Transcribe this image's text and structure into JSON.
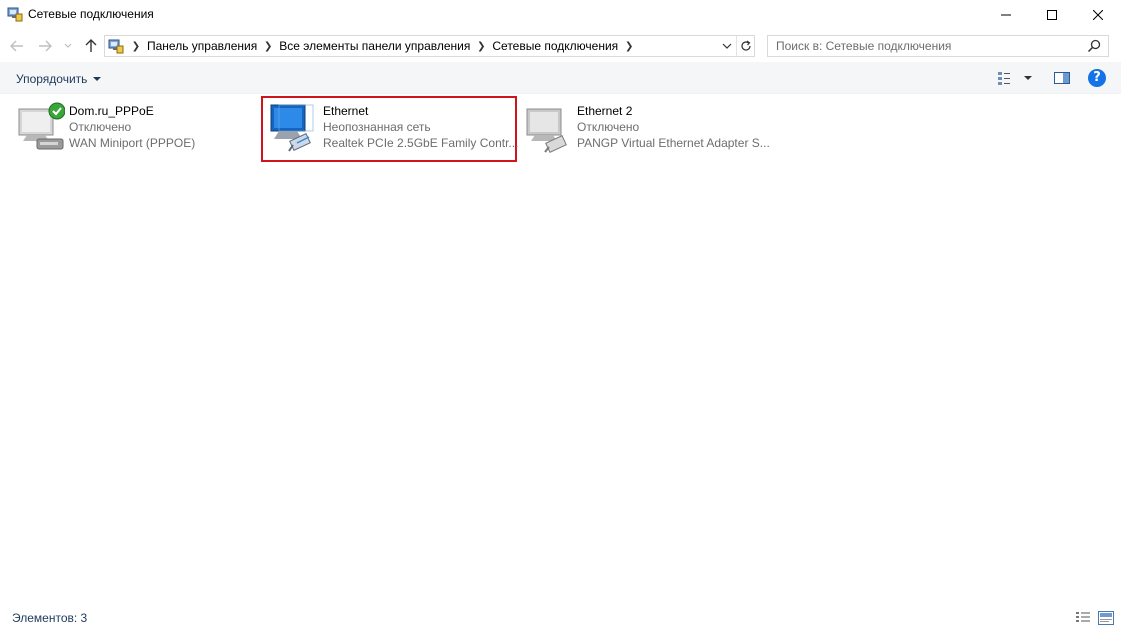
{
  "window": {
    "title": "Сетевые подключения",
    "controls": {
      "minimize": "minimize-icon",
      "maximize": "maximize-icon",
      "close": "close-icon"
    }
  },
  "nav": {
    "breadcrumbs": [
      "Панель управления",
      "Все элементы панели управления",
      "Сетевые подключения"
    ],
    "search_placeholder": "Поиск в: Сетевые подключения"
  },
  "toolbar": {
    "organize_label": "Упорядочить",
    "help_label": "?"
  },
  "connections": [
    {
      "name": "Dom.ru_PPPoE",
      "status": "Отключено",
      "device": "WAN Miniport (PPPOE)",
      "icon": "dialup-connection-icon",
      "selected": false
    },
    {
      "name": "Ethernet",
      "status": "Неопознанная сеть",
      "device": "Realtek PCIe 2.5GbE Family Contr...",
      "icon": "ethernet-connection-icon",
      "selected": true
    },
    {
      "name": "Ethernet 2",
      "status": "Отключено",
      "device": "PANGP Virtual Ethernet Adapter S...",
      "icon": "ethernet-disabled-icon",
      "selected": false
    }
  ],
  "statusbar": {
    "items_count": "Элементов: 3"
  },
  "colors": {
    "selection_border": "#d0141c",
    "toolbar_text": "#1e395b",
    "help_blue": "#1473e6",
    "secondary_text": "#6d6d6d"
  }
}
